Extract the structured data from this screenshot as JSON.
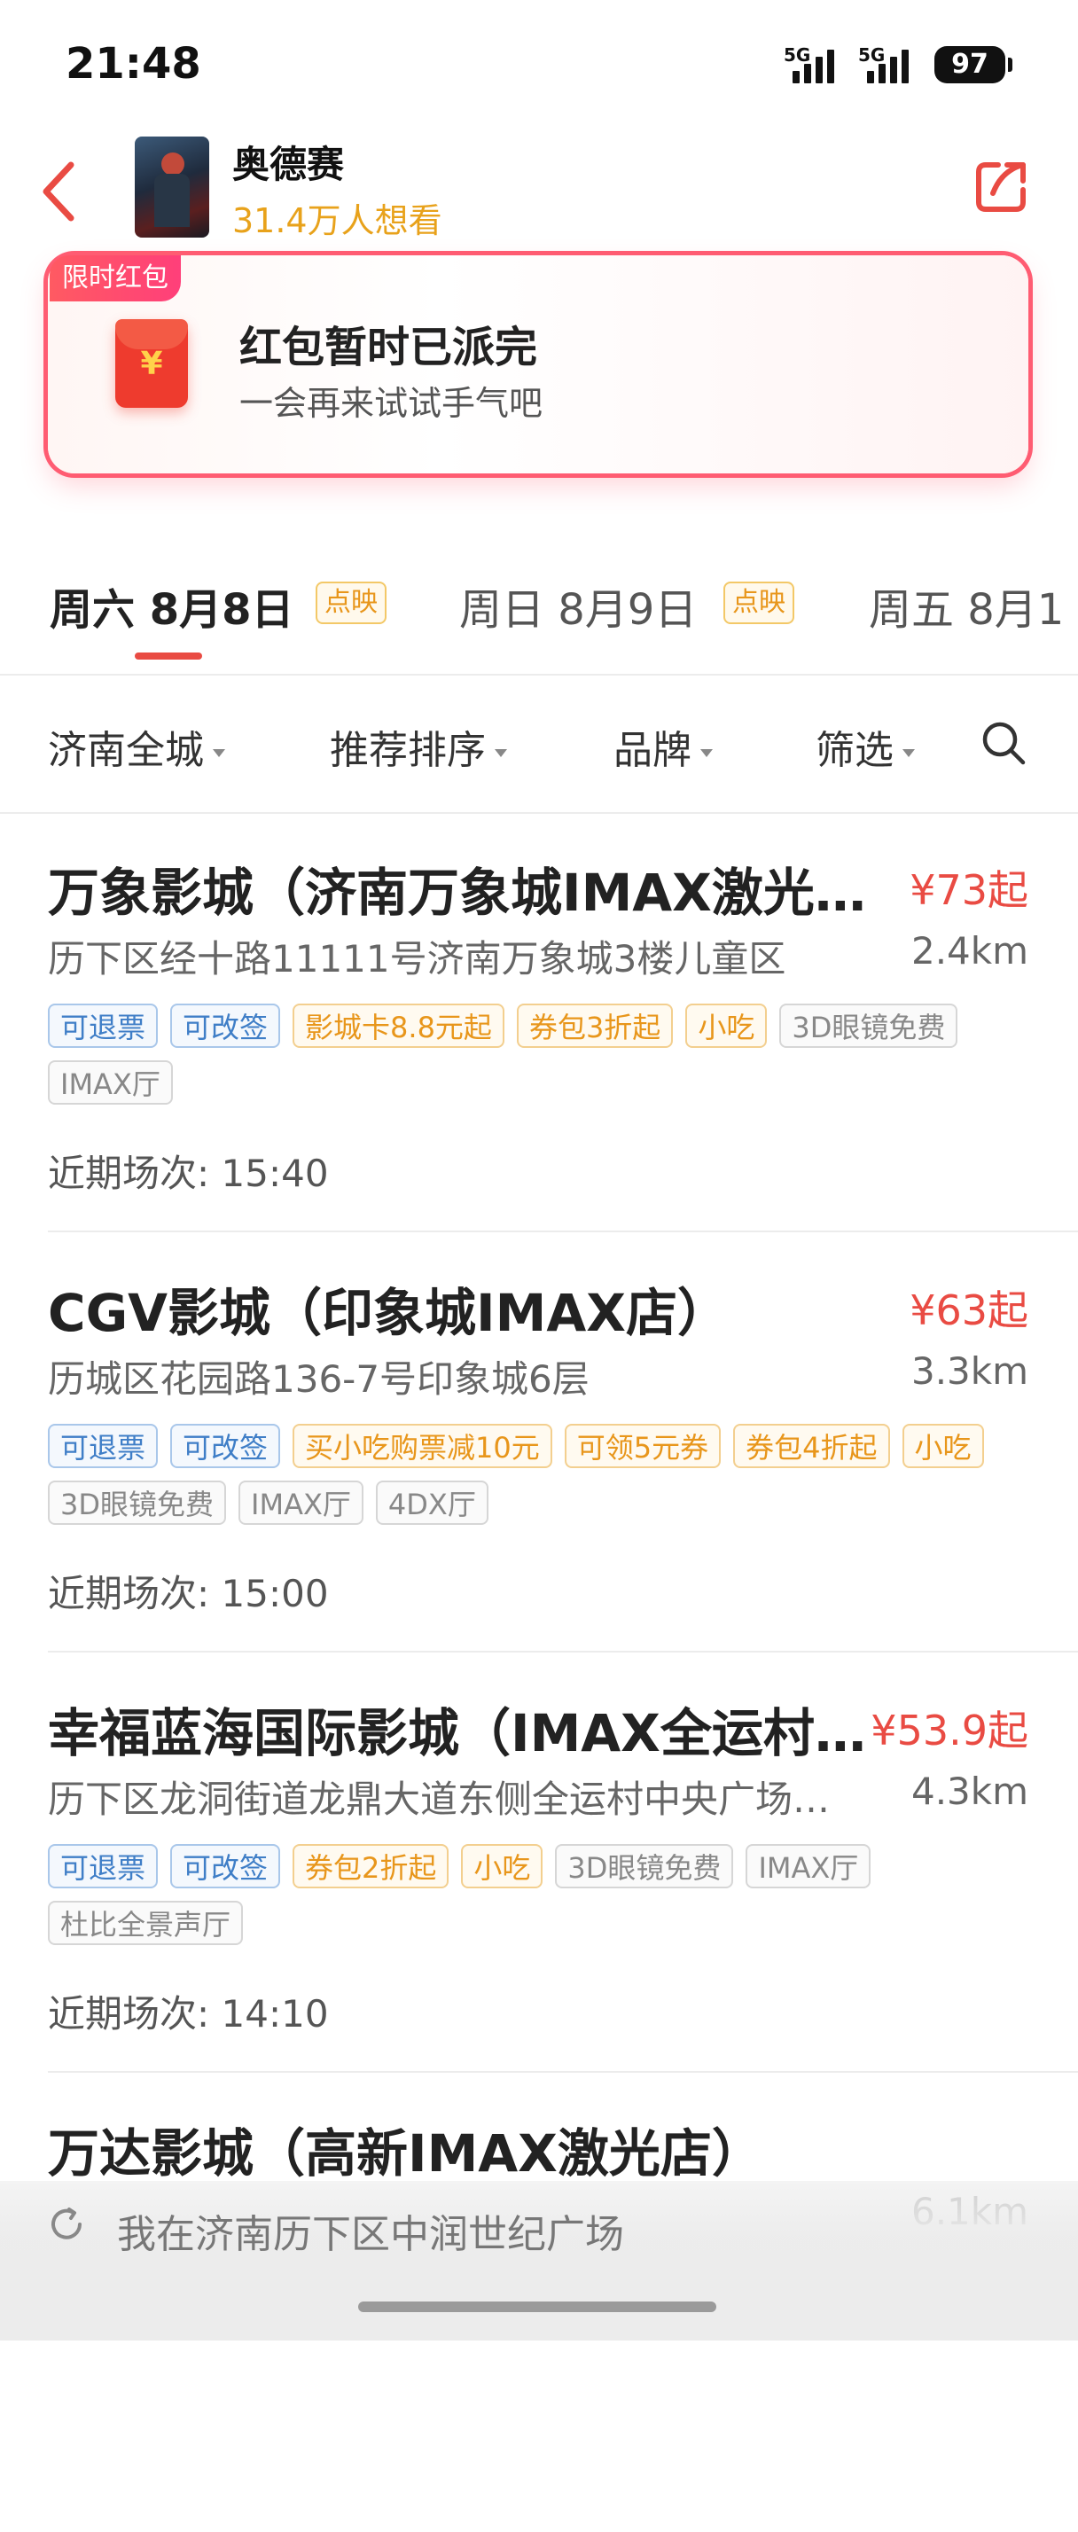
{
  "status_bar": {
    "time": "21:48",
    "signal1": "5G",
    "signal2": "5G",
    "battery": "97"
  },
  "header": {
    "title": "奥德赛",
    "want_count": "31.4万人想看"
  },
  "red_packet": {
    "tag": "限时红包",
    "title": "红包暂时已派完",
    "subtitle": "一会再来试试手气吧",
    "icon_symbol": "¥"
  },
  "date_tabs": [
    {
      "label": "周六 8月8日",
      "badge": "点映"
    },
    {
      "label": "周日 8月9日",
      "badge": "点映"
    },
    {
      "label": "周五 8月1"
    }
  ],
  "filters": {
    "city": "济南全城",
    "sort": "推荐排序",
    "brand": "品牌",
    "filter": "筛选"
  },
  "cinemas": [
    {
      "name": "万象影城（济南万象城IMAX激光店）",
      "price": "¥73起",
      "address": "历下区经十路11111号济南万象城3楼儿童区",
      "distance": "2.4km",
      "tags": [
        {
          "text": "可退票",
          "color": "blue"
        },
        {
          "text": "可改签",
          "color": "blue"
        },
        {
          "text": "影城卡8.8元起",
          "color": "orange"
        },
        {
          "text": "券包3折起",
          "color": "orange"
        },
        {
          "text": "小吃",
          "color": "orange"
        },
        {
          "text": "3D眼镜免费",
          "color": "gray"
        },
        {
          "text": "IMAX厅",
          "color": "gray"
        }
      ],
      "next": "近期场次: 15:40"
    },
    {
      "name": "CGV影城（印象城IMAX店）",
      "price": "¥63起",
      "address": "历城区花园路136-7号印象城6层",
      "distance": "3.3km",
      "tags": [
        {
          "text": "可退票",
          "color": "blue"
        },
        {
          "text": "可改签",
          "color": "blue"
        },
        {
          "text": "买小吃购票减10元",
          "color": "orange"
        },
        {
          "text": "可领5元券",
          "color": "orange"
        },
        {
          "text": "券包4折起",
          "color": "orange"
        },
        {
          "text": "小吃",
          "color": "orange"
        },
        {
          "text": "3D眼镜免费",
          "color": "gray"
        },
        {
          "text": "IMAX厅",
          "color": "gray"
        },
        {
          "text": "4DX厅",
          "color": "gray"
        }
      ],
      "next": "近期场次: 15:00"
    },
    {
      "name": "幸福蓝海国际影城（IMAX全运村店）",
      "price": "¥53.9起",
      "address": "历下区龙洞街道龙鼎大道东侧全运村中央广场娱乐城",
      "distance": "4.3km",
      "tags": [
        {
          "text": "可退票",
          "color": "blue"
        },
        {
          "text": "可改签",
          "color": "blue"
        },
        {
          "text": "券包2折起",
          "color": "orange"
        },
        {
          "text": "小吃",
          "color": "orange"
        },
        {
          "text": "3D眼镜免费",
          "color": "gray"
        },
        {
          "text": "IMAX厅",
          "color": "gray"
        },
        {
          "text": "杜比全景声厅",
          "color": "gray"
        }
      ],
      "next": "近期场次: 14:10"
    },
    {
      "name": "万达影城（高新IMAX激光店）",
      "price": "",
      "address": "",
      "distance": "6.1km",
      "tags": [],
      "next": ""
    }
  ],
  "location_bar": {
    "text": "我在济南历下区中润世纪广场"
  },
  "colors": {
    "accent": "#e94b43",
    "want": "#e8a21b",
    "tag_blue": "#3f7ec7",
    "tag_orange": "#e8961b",
    "tag_gray": "#888888"
  },
  "icons": [
    "back-arrow-icon",
    "share-icon",
    "red-envelope-icon",
    "search-icon",
    "location-refresh-icon"
  ]
}
